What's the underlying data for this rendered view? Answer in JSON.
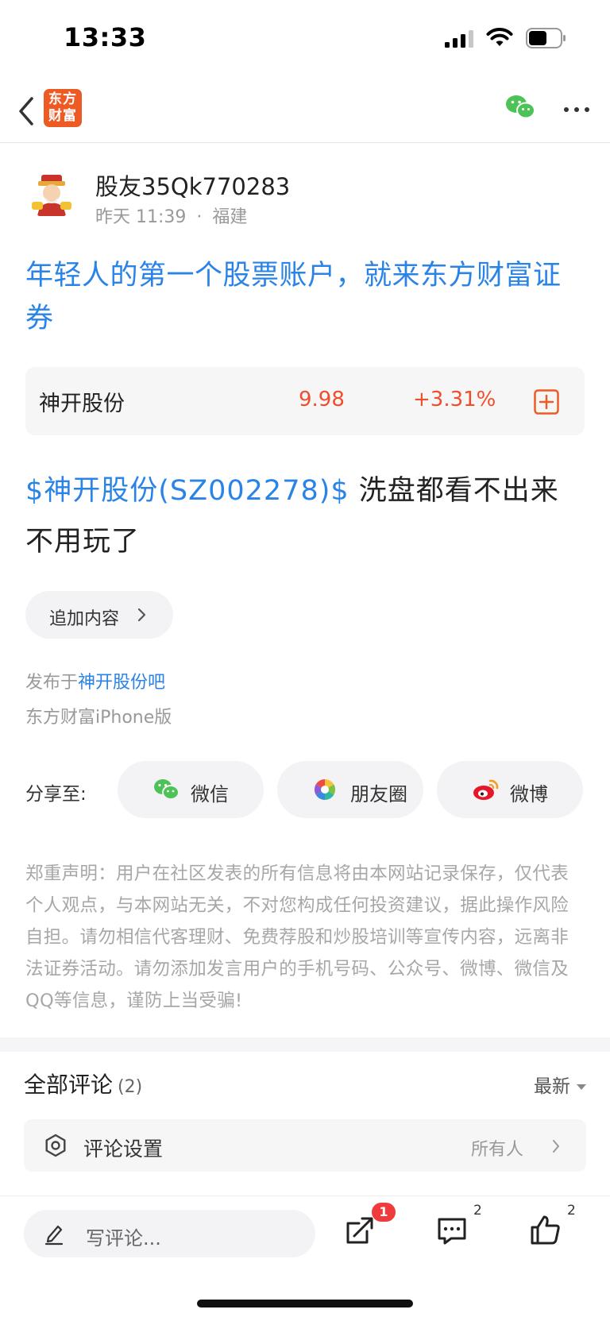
{
  "status_bar": {
    "time": "13:33"
  },
  "nav": {
    "logo_text": "东方财富",
    "back_icon": "chevron-left-icon",
    "wechat_icon": "wechat-icon",
    "more_icon": "more-dots-icon"
  },
  "author": {
    "name": "股友35Qk770283",
    "time": "昨天 11:39",
    "separator": "·",
    "location": "福建"
  },
  "post": {
    "title": "年轻人的第一个股票账户，就来东方财富证券",
    "stock_card": {
      "name": "神开股份",
      "price": "9.98",
      "change": "+3.31%"
    },
    "stock_tag": "$神开股份(SZ002278)$",
    "body_text": " 洗盘都看不出来不用玩了",
    "add_content_label": "追加内容",
    "published_prefix": "发布于",
    "published_bar": "神开股份吧",
    "client": "东方财富iPhone版"
  },
  "share": {
    "label": "分享至:",
    "options": [
      {
        "label": "微信",
        "icon": "wechat-icon"
      },
      {
        "label": "朋友圈",
        "icon": "moments-icon"
      },
      {
        "label": "微博",
        "icon": "weibo-icon"
      }
    ]
  },
  "disclaimer": "郑重声明：用户在社区发表的所有信息将由本网站记录保存，仅代表个人观点，与本网站无关，不对您构成任何投资建议，据此操作风险自担。请勿相信代客理财、免费荐股和炒股培训等宣传内容，远离非法证券活动。请勿添加发言用户的手机号码、公众号、微博、微信及QQ等信息，谨防上当受骗!",
  "comments": {
    "title": "全部评论",
    "count": "(2)",
    "sort_label": "最新",
    "settings_label": "评论设置",
    "settings_value": "所有人"
  },
  "bottom_bar": {
    "input_placeholder": "写评论...",
    "share_badge": "1",
    "comment_count": "2",
    "like_count": "2"
  },
  "colors": {
    "accent_blue": "#2a83e6",
    "stock_red": "#ef4e2c",
    "brand_orange": "#ee5a24",
    "badge_red": "#ef3b3b"
  }
}
